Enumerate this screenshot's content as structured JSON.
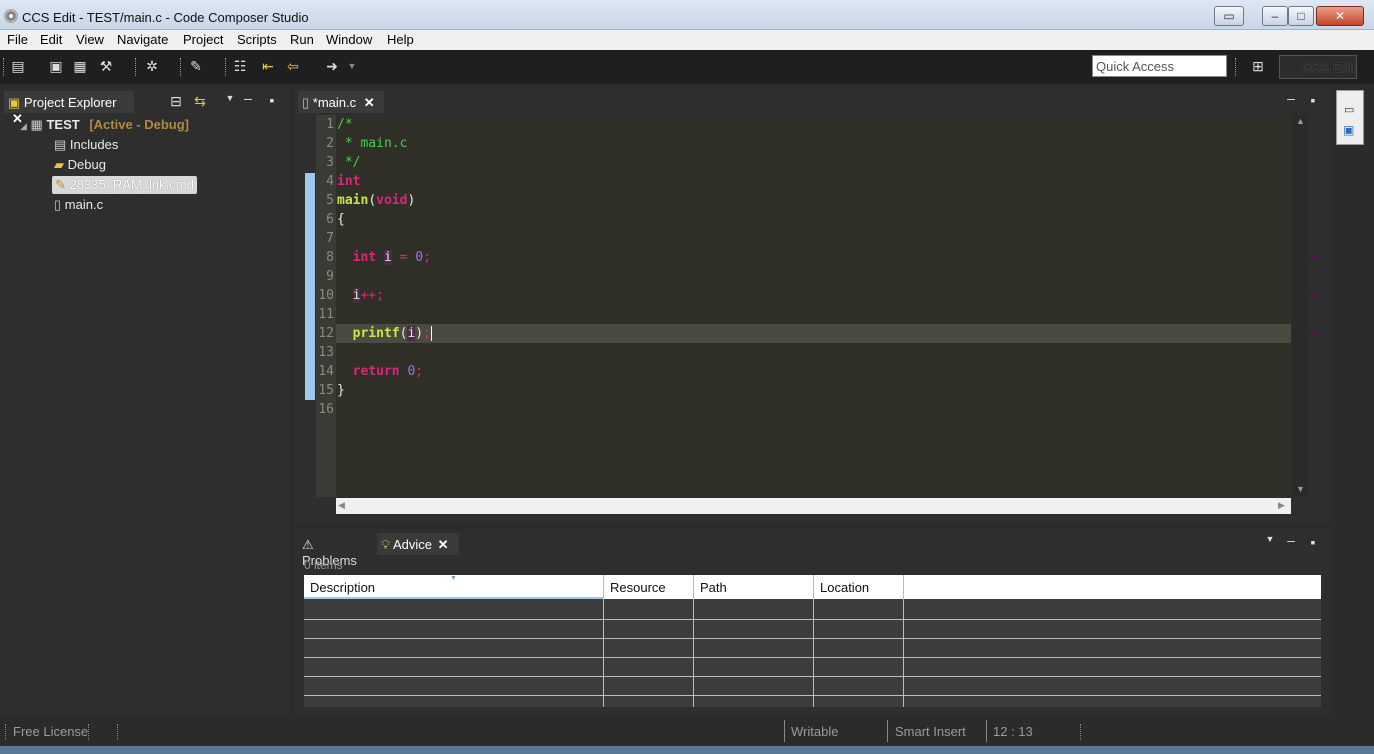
{
  "window": {
    "title": "CCS Edit - TEST/main.c - Code Composer Studio",
    "controls": {
      "restore": "▭",
      "minimize": "–",
      "maximize": "□",
      "close": "✕"
    }
  },
  "menu": {
    "items": [
      "File",
      "Edit",
      "View",
      "Navigate",
      "Project",
      "Scripts",
      "Run",
      "Window",
      "Help"
    ]
  },
  "toolbar": {
    "quick_access_placeholder": "Quick Access",
    "perspective_label": "CCS Edit"
  },
  "project_explorer": {
    "tab_label": "Project Explorer",
    "project_name": "TEST",
    "project_status": "[Active - Debug]",
    "items": [
      "Includes",
      "Debug",
      "28335_RAM_lnk.cmd",
      "main.c"
    ]
  },
  "editor": {
    "tab_label": "*main.c",
    "line_numbers": [
      "1",
      "2",
      "3",
      "4",
      "5",
      "6",
      "7",
      "8",
      "9",
      "10",
      "11",
      "12",
      "13",
      "14",
      "15",
      "16"
    ]
  },
  "bottom_panel": {
    "tab_problems": "Problems",
    "tab_advice": "Advice",
    "item_count": "0 items",
    "columns": [
      "Description",
      "Resource",
      "Path",
      "Location"
    ]
  },
  "status_bar": {
    "license": "Free License",
    "writable": "Writable",
    "insert_mode": "Smart Insert",
    "cursor_position": "12 : 13"
  },
  "colors": {
    "keyword": "#e0247a",
    "function": "#c9e846",
    "comment": "#4ec94e",
    "number": "#9d73f0",
    "current_line": "#4a4a40"
  }
}
